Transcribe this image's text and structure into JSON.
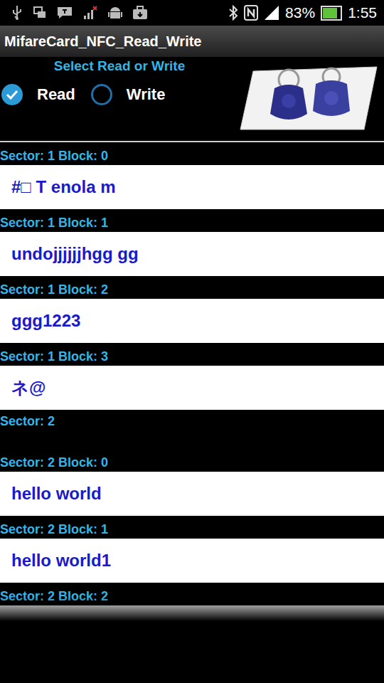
{
  "status_bar": {
    "battery": "83%",
    "battery_level": 0.83,
    "time": "1:55"
  },
  "app_bar": {
    "title": "MifareCard_NFC_Read_Write"
  },
  "mode": {
    "prompt": "Select Read or Write",
    "options": [
      {
        "label": "Read",
        "selected": true
      },
      {
        "label": "Write",
        "selected": false
      }
    ]
  },
  "blocks": [
    {
      "kind": "block",
      "label": "Sector: 1 Block: 0",
      "value": "#□ T enola m"
    },
    {
      "kind": "block",
      "label": "Sector: 1 Block: 1",
      "value": "undojjjjjjhgg gg"
    },
    {
      "kind": "block",
      "label": "Sector: 1 Block: 2",
      "value": "ggg1223"
    },
    {
      "kind": "block",
      "label": "Sector: 1 Block: 3",
      "value": "ネ@"
    },
    {
      "kind": "sector",
      "label": "Sector: 2",
      "value": ""
    },
    {
      "kind": "block",
      "label": "Sector: 2 Block: 0",
      "value": "hello world"
    },
    {
      "kind": "block",
      "label": "Sector: 2 Block: 1",
      "value": "hello world1"
    },
    {
      "kind": "block",
      "label": "Sector: 2 Block: 2",
      "value": ""
    }
  ]
}
